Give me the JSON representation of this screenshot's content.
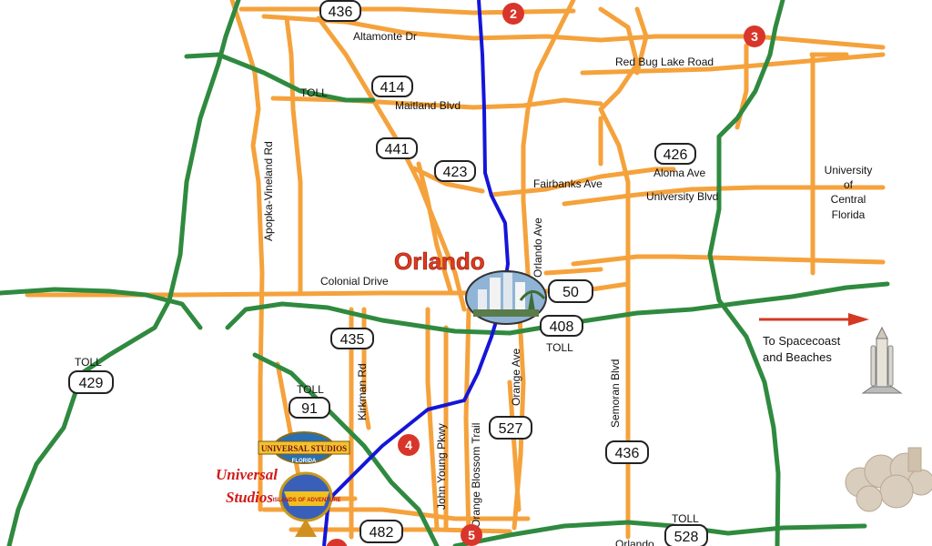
{
  "map": {
    "city_label": "Orlando",
    "colors": {
      "orange_roads": "#f5a23c",
      "green_toll_roads": "#2f8a3f",
      "blue_i4": "#1515d8",
      "marker_red": "#d9362b",
      "arrow_red": "#d33a22"
    },
    "street_labels": {
      "altamonte": "Altamonte Dr",
      "red_bug": "Red Bug Lake Road",
      "maitland": "Maitland Blvd",
      "fairbanks": "Fairbanks Ave",
      "aloma": "Aloma Ave",
      "university_blvd": "University Blvd",
      "colonial": "Colonial Drive",
      "apopka": "Apopka-Vineland Rd",
      "orlando_ave": "Orlando Ave",
      "orange_ave": "Orange Ave",
      "obt": "Orange Blossom Trail",
      "john_young": "John Young Pkwy",
      "kirkman": "Kirkman Rd",
      "semoran": "Semoran Blvd",
      "orlando_bottom": "Orlando"
    },
    "toll_label": "TOLL",
    "ucf": [
      "University",
      "of",
      "Central",
      "Florida"
    ],
    "spacecoast": [
      "To Spacecoast",
      "and Beaches"
    ],
    "route_shields": {
      "r436_top": "436",
      "r414": "414",
      "r441": "441",
      "r423": "423",
      "r426": "426",
      "r50": "50",
      "r408": "408",
      "r435": "435",
      "r429": "429",
      "r91": "91",
      "r527": "527",
      "r436_bottom": "436",
      "r482": "482",
      "r528": "528"
    },
    "markers": {
      "m2": "2",
      "m3": "3",
      "m4": "4",
      "m5": "5"
    },
    "logos": {
      "universal_studios_badge": "UNIVERSAL STUDIOS",
      "universal_studios_badge_sub": "FLORIDA",
      "universal_studios_text": [
        "Universal",
        "Studios"
      ],
      "islands_badge": "ISLANDS OF ADVENTURE"
    }
  }
}
